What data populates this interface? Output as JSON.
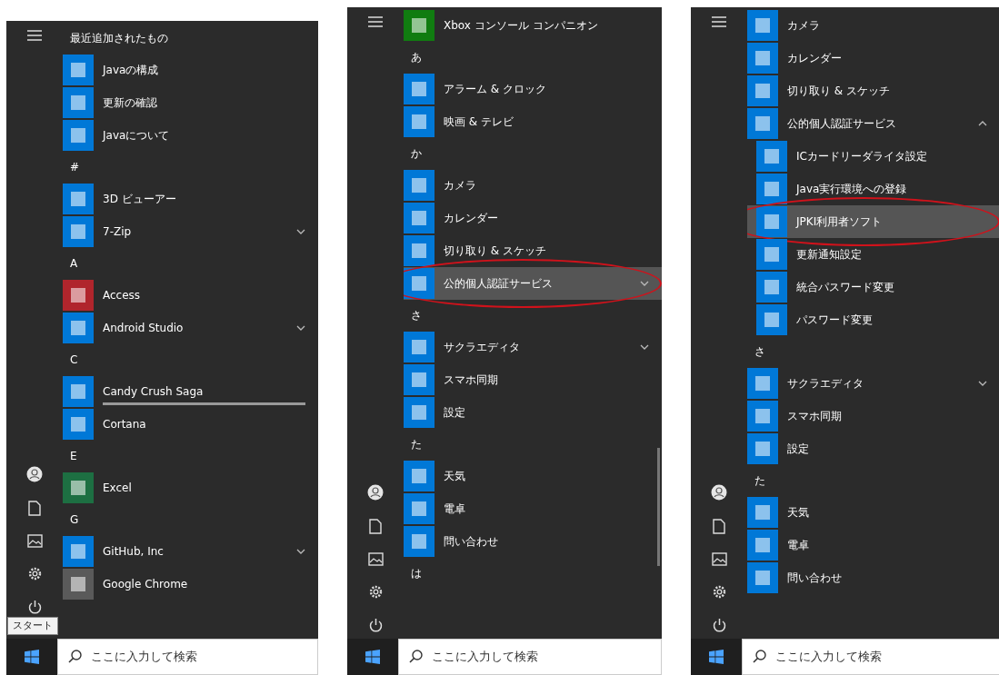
{
  "panels": [
    {
      "items": [
        {
          "kind": "header",
          "label": "最近追加されたもの"
        },
        {
          "kind": "app",
          "label": "Javaの構成",
          "color": "#0078d7",
          "selected": false
        },
        {
          "kind": "app",
          "label": "更新の確認",
          "color": "#0078d7",
          "selected": false
        },
        {
          "kind": "app",
          "label": "Javaについて",
          "color": "#0078d7",
          "selected": false
        },
        {
          "kind": "header",
          "label": "#"
        },
        {
          "kind": "app",
          "label": "3D ビューアー",
          "color": "#0078d7",
          "selected": false
        },
        {
          "kind": "app",
          "label": "7-Zip",
          "color": "#0078d7",
          "selected": false,
          "expanded": false
        },
        {
          "kind": "header",
          "label": "A"
        },
        {
          "kind": "app",
          "label": "Access",
          "color": "#b0252c",
          "selected": false
        },
        {
          "kind": "app",
          "label": "Android Studio",
          "color": "#0078d7",
          "selected": false,
          "expanded": false
        },
        {
          "kind": "header",
          "label": "C"
        },
        {
          "kind": "app",
          "label": "Candy Crush Saga",
          "color": "#0078d7",
          "selected": false,
          "installing": true
        },
        {
          "kind": "app",
          "label": "Cortana",
          "color": "#0078d7",
          "selected": false
        },
        {
          "kind": "header",
          "label": "E"
        },
        {
          "kind": "app",
          "label": "Excel",
          "color": "#1d6f42",
          "selected": false
        },
        {
          "kind": "header",
          "label": "G"
        },
        {
          "kind": "app",
          "label": "GitHub, Inc",
          "color": "#0078d7",
          "selected": false,
          "expanded": false
        },
        {
          "kind": "app",
          "label": "Google Chrome",
          "color": "#5a5a5a",
          "selected": false
        }
      ],
      "tooltip": "スタート",
      "scrollbar_shown": false,
      "search": {
        "placeholder": "ここに入力して検索"
      }
    },
    {
      "items": [
        {
          "kind": "app",
          "label": "Xbox コンソール コンパニオン",
          "color": "#107c10",
          "selected": false
        },
        {
          "kind": "header",
          "label": "あ"
        },
        {
          "kind": "app",
          "label": "アラーム & クロック",
          "color": "#0078d7",
          "selected": false
        },
        {
          "kind": "app",
          "label": "映画 & テレビ",
          "color": "#0078d7",
          "selected": false
        },
        {
          "kind": "header",
          "label": "か"
        },
        {
          "kind": "app",
          "label": "カメラ",
          "color": "#0078d7",
          "selected": false
        },
        {
          "kind": "app",
          "label": "カレンダー",
          "color": "#0078d7",
          "selected": false
        },
        {
          "kind": "app",
          "label": "切り取り & スケッチ",
          "color": "#0078d7",
          "selected": false
        },
        {
          "kind": "app",
          "label": "公的個人認証サービス",
          "color": "#0078d7",
          "selected": true,
          "expanded": false,
          "circled": true
        },
        {
          "kind": "header",
          "label": "さ"
        },
        {
          "kind": "app",
          "label": "サクラエディタ",
          "color": "#0078d7",
          "selected": false,
          "expanded": false
        },
        {
          "kind": "app",
          "label": "スマホ同期",
          "color": "#0078d7",
          "selected": false
        },
        {
          "kind": "app",
          "label": "設定",
          "color": "#0078d7",
          "selected": false
        },
        {
          "kind": "header",
          "label": "た"
        },
        {
          "kind": "app",
          "label": "天気",
          "color": "#0078d7",
          "selected": false
        },
        {
          "kind": "app",
          "label": "電卓",
          "color": "#0078d7",
          "selected": false
        },
        {
          "kind": "app",
          "label": "問い合わせ",
          "color": "#0078d7",
          "selected": false
        },
        {
          "kind": "header",
          "label": "は"
        }
      ],
      "scrollbar_shown": true,
      "search": {
        "placeholder": "ここに入力して検索"
      }
    },
    {
      "items": [
        {
          "kind": "app",
          "label": "カメラ",
          "color": "#0078d7",
          "selected": false
        },
        {
          "kind": "app",
          "label": "カレンダー",
          "color": "#0078d7",
          "selected": false
        },
        {
          "kind": "app",
          "label": "切り取り & スケッチ",
          "color": "#0078d7",
          "selected": false
        },
        {
          "kind": "app",
          "label": "公的個人認証サービス",
          "color": "#0078d7",
          "selected": false,
          "expanded": true,
          "children": [
            {
              "kind": "app",
              "label": "ICカードリーダライタ設定",
              "color": "#0078d7",
              "selected": false
            },
            {
              "kind": "app",
              "label": "Java実行環境への登録",
              "color": "#0078d7",
              "selected": false
            },
            {
              "kind": "app",
              "label": "JPKI利用者ソフト",
              "color": "#0078d7",
              "selected": true,
              "circled": true
            },
            {
              "kind": "app",
              "label": "更新通知設定",
              "color": "#0078d7",
              "selected": false
            },
            {
              "kind": "app",
              "label": "統合パスワード変更",
              "color": "#0078d7",
              "selected": false
            },
            {
              "kind": "app",
              "label": "パスワード変更",
              "color": "#0078d7",
              "selected": false
            }
          ]
        },
        {
          "kind": "header",
          "label": "さ"
        },
        {
          "kind": "app",
          "label": "サクラエディタ",
          "color": "#0078d7",
          "selected": false,
          "expanded": false
        },
        {
          "kind": "app",
          "label": "スマホ同期",
          "color": "#0078d7",
          "selected": false
        },
        {
          "kind": "app",
          "label": "設定",
          "color": "#0078d7",
          "selected": false
        },
        {
          "kind": "header",
          "label": "た"
        },
        {
          "kind": "app",
          "label": "天気",
          "color": "#0078d7",
          "selected": false
        },
        {
          "kind": "app",
          "label": "電卓",
          "color": "#0078d7",
          "selected": false
        },
        {
          "kind": "app",
          "label": "問い合わせ",
          "color": "#0078d7",
          "selected": false
        }
      ],
      "scrollbar_shown": false,
      "search": {
        "placeholder": "ここに入力して検索"
      }
    }
  ]
}
